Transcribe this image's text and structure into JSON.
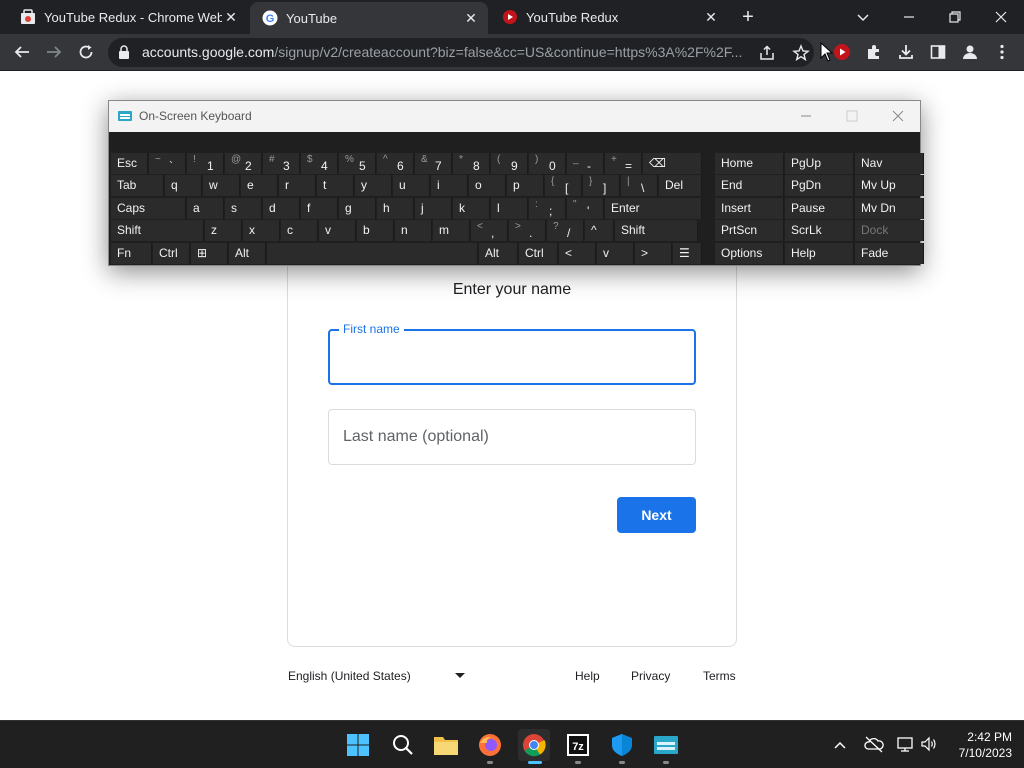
{
  "browser": {
    "tabs": [
      {
        "title": "YouTube Redux - Chrome Web Store",
        "active": false
      },
      {
        "title": "YouTube",
        "active": true
      },
      {
        "title": "YouTube Redux",
        "active": false
      }
    ],
    "address": {
      "host": "accounts.google.com",
      "path": "/signup/v2/createaccount?biz=false&cc=US&continue=https%3A%2F%2F..."
    }
  },
  "osk": {
    "title": "On-Screen Keyboard",
    "rows": [
      [
        {
          "t": "Esc"
        },
        {
          "s": "~",
          "m": "`"
        },
        {
          "s": "!",
          "m": "1"
        },
        {
          "s": "@",
          "m": "2"
        },
        {
          "s": "#",
          "m": "3"
        },
        {
          "s": "$",
          "m": "4"
        },
        {
          "s": "%",
          "m": "5"
        },
        {
          "s": "^",
          "m": "6"
        },
        {
          "s": "&",
          "m": "7"
        },
        {
          "s": "*",
          "m": "8"
        },
        {
          "s": "(",
          "m": "9"
        },
        {
          "s": ")",
          "m": "0"
        },
        {
          "s": "_",
          "m": "-"
        },
        {
          "s": "+",
          "m": "="
        },
        {
          "t": "⌫"
        },
        {
          "t": "Home"
        },
        {
          "t": "PgUp"
        },
        {
          "t": "Nav"
        }
      ],
      [
        {
          "t": "Tab"
        },
        {
          "t": "q"
        },
        {
          "t": "w"
        },
        {
          "t": "e"
        },
        {
          "t": "r"
        },
        {
          "t": "t"
        },
        {
          "t": "y"
        },
        {
          "t": "u"
        },
        {
          "t": "i"
        },
        {
          "t": "o"
        },
        {
          "t": "p"
        },
        {
          "s": "{",
          "m": "["
        },
        {
          "s": "}",
          "m": "]"
        },
        {
          "s": "|",
          "m": "\\"
        },
        {
          "t": "Del"
        },
        {
          "t": "End"
        },
        {
          "t": "PgDn"
        },
        {
          "t": "Mv Up"
        }
      ],
      [
        {
          "t": "Caps"
        },
        {
          "t": "a"
        },
        {
          "t": "s"
        },
        {
          "t": "d"
        },
        {
          "t": "f"
        },
        {
          "t": "g"
        },
        {
          "t": "h"
        },
        {
          "t": "j"
        },
        {
          "t": "k"
        },
        {
          "t": "l"
        },
        {
          "s": ":",
          "m": ";"
        },
        {
          "s": "\"",
          "m": "'"
        },
        {
          "t": "Enter"
        },
        {
          "t": "Insert"
        },
        {
          "t": "Pause"
        },
        {
          "t": "Mv Dn"
        }
      ],
      [
        {
          "t": "Shift"
        },
        {
          "t": "z"
        },
        {
          "t": "x"
        },
        {
          "t": "c"
        },
        {
          "t": "v"
        },
        {
          "t": "b"
        },
        {
          "t": "n"
        },
        {
          "t": "m"
        },
        {
          "s": "<",
          "m": ","
        },
        {
          "s": ">",
          "m": "."
        },
        {
          "s": "?",
          "m": "/"
        },
        {
          "t": "^"
        },
        {
          "t": "Shift"
        },
        {
          "t": "PrtScn"
        },
        {
          "t": "ScrLk"
        },
        {
          "t": "Dock"
        }
      ],
      [
        {
          "t": "Fn"
        },
        {
          "t": "Ctrl"
        },
        {
          "t": "⊞"
        },
        {
          "t": "Alt"
        },
        {
          "t": ""
        },
        {
          "t": "Alt"
        },
        {
          "t": "Ctrl"
        },
        {
          "t": "<"
        },
        {
          "t": "v"
        },
        {
          "t": ">"
        },
        {
          "t": "☰"
        },
        {
          "t": "Options"
        },
        {
          "t": "Help"
        },
        {
          "t": "Fade"
        }
      ]
    ]
  },
  "form": {
    "heading": "Enter your name",
    "first_label": "First name",
    "first_value": "",
    "last_placeholder": "Last name (optional)",
    "next_label": "Next"
  },
  "footer": {
    "language": "English (United States)",
    "help": "Help",
    "privacy": "Privacy",
    "terms": "Terms"
  },
  "taskbar": {
    "time": "2:42 PM",
    "date": "7/10/2023",
    "apps": [
      "start-icon",
      "search-icon",
      "file-explorer-icon",
      "firefox-icon",
      "chrome-icon",
      "7zip-icon",
      "defender-icon",
      "on-screen-keyboard-icon"
    ]
  },
  "colors": {
    "accent": "#1a73e8",
    "chrome_dark": "#202124",
    "toolbar": "#35363a"
  }
}
